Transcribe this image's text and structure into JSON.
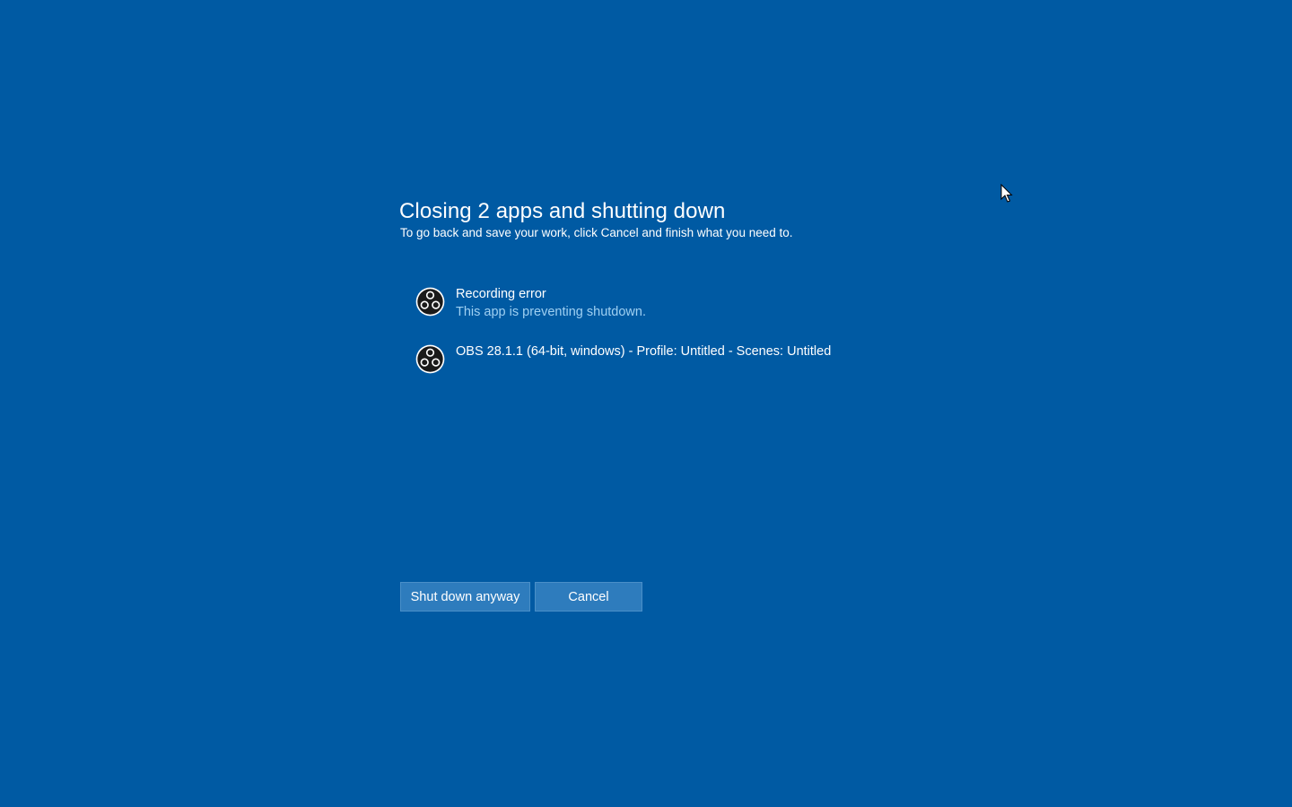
{
  "dialog": {
    "title": "Closing 2 apps and shutting down",
    "subtitle": "To go back and save your work, click Cancel and finish what you need to."
  },
  "apps": [
    {
      "icon": "obs-icon",
      "name": "Recording error",
      "status": "This app is preventing shutdown."
    },
    {
      "icon": "obs-icon",
      "name": "OBS 28.1.1 (64-bit, windows) - Profile: Untitled - Scenes: Untitled",
      "status": ""
    }
  ],
  "buttons": {
    "shutdown_label": "Shut down anyway",
    "cancel_label": "Cancel"
  },
  "colors": {
    "background": "#005aa3",
    "button": "#2e7cbd",
    "status_text": "#9fd0f2",
    "text": "#ffffff"
  }
}
